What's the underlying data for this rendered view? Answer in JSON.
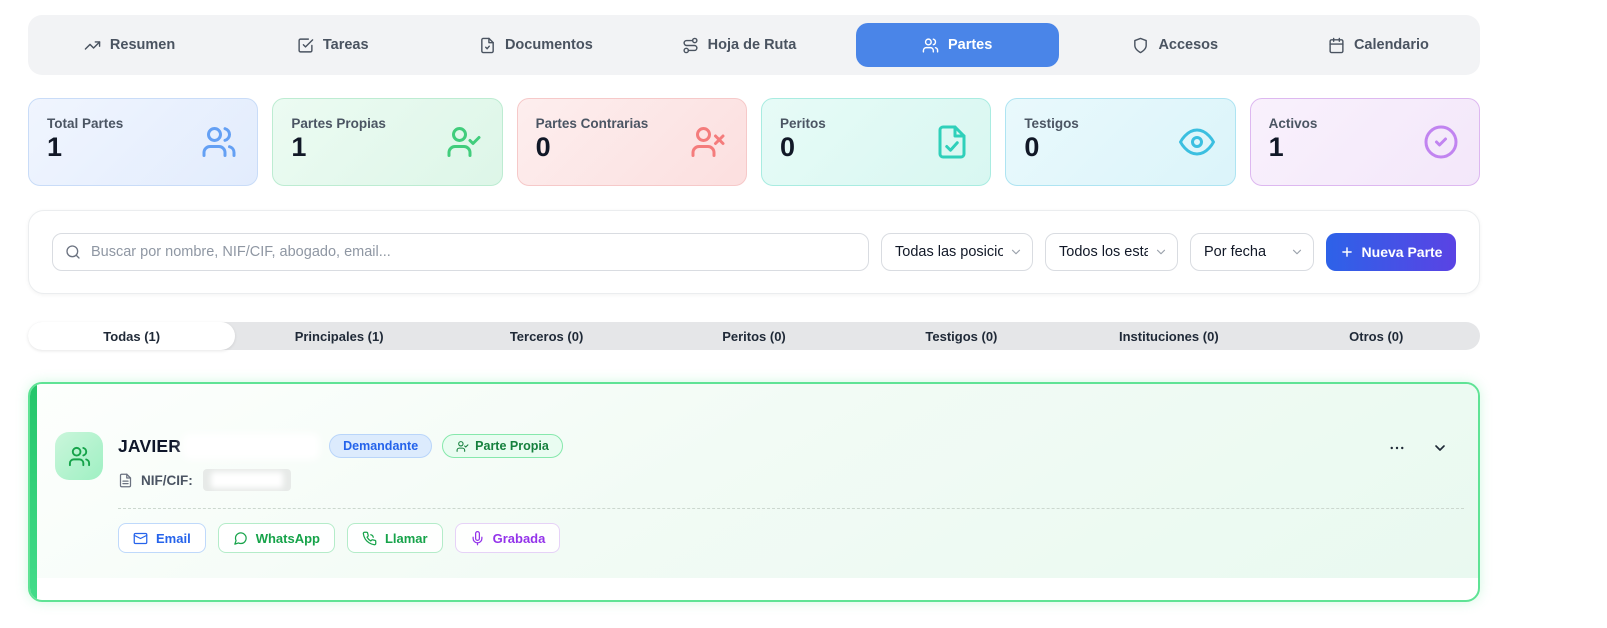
{
  "nav": {
    "tabs": [
      {
        "label": "Resumen",
        "icon": "trending-up-icon"
      },
      {
        "label": "Tareas",
        "icon": "check-square-icon"
      },
      {
        "label": "Documentos",
        "icon": "document-icon"
      },
      {
        "label": "Hoja de Ruta",
        "icon": "route-icon"
      },
      {
        "label": "Partes",
        "icon": "users-icon"
      },
      {
        "label": "Accesos",
        "icon": "shield-icon"
      },
      {
        "label": "Calendario",
        "icon": "calendar-icon"
      }
    ],
    "active_tab": "Partes",
    "active_color": "#4a85e8"
  },
  "stats": {
    "cards": [
      {
        "label": "Total Partes",
        "value": "1",
        "icon": "users-icon",
        "accent": "#64a0f4"
      },
      {
        "label": "Partes Propias",
        "value": "1",
        "icon": "user-check-icon",
        "accent": "#41cd7c"
      },
      {
        "label": "Partes Contrarias",
        "value": "0",
        "icon": "user-x-icon",
        "accent": "#f47c7c"
      },
      {
        "label": "Peritos",
        "value": "0",
        "icon": "file-check-icon",
        "accent": "#2fd0ba"
      },
      {
        "label": "Testigos",
        "value": "0",
        "icon": "eye-icon",
        "accent": "#3bbfe0"
      },
      {
        "label": "Activos",
        "value": "1",
        "icon": "check-circle-icon",
        "accent": "#c184f0"
      }
    ]
  },
  "toolbar": {
    "search": {
      "placeholder": "Buscar por nombre, NIF/CIF, abogado, email...",
      "value": ""
    },
    "position_filter": "Todas las posicion",
    "status_filter": "Todos los estad",
    "sort_filter": "Por fecha",
    "new_party_button": "Nueva Parte"
  },
  "filter_tabs": {
    "tabs": [
      {
        "label": "Todas (1)"
      },
      {
        "label": "Principales (1)"
      },
      {
        "label": "Terceros (0)"
      },
      {
        "label": "Peritos (0)"
      },
      {
        "label": "Testigos (0)"
      },
      {
        "label": "Instituciones (0)"
      },
      {
        "label": "Otros (0)"
      }
    ],
    "active_tab": "Todas (1)"
  },
  "party_card": {
    "name": "JAVIER",
    "position_badge": "Demandante",
    "type_badge": "Parte Propia",
    "nif_label": "NIF/CIF:",
    "actions": [
      {
        "label": "Email",
        "icon": "mail-icon",
        "color": "#2563eb"
      },
      {
        "label": "WhatsApp",
        "icon": "message-circle-icon",
        "color": "#16a34a"
      },
      {
        "label": "Llamar",
        "icon": "phone-icon",
        "color": "#16a34a"
      },
      {
        "label": "Grabada",
        "icon": "mic-icon",
        "color": "#9333ea"
      }
    ],
    "accent_color": "#34d987"
  }
}
